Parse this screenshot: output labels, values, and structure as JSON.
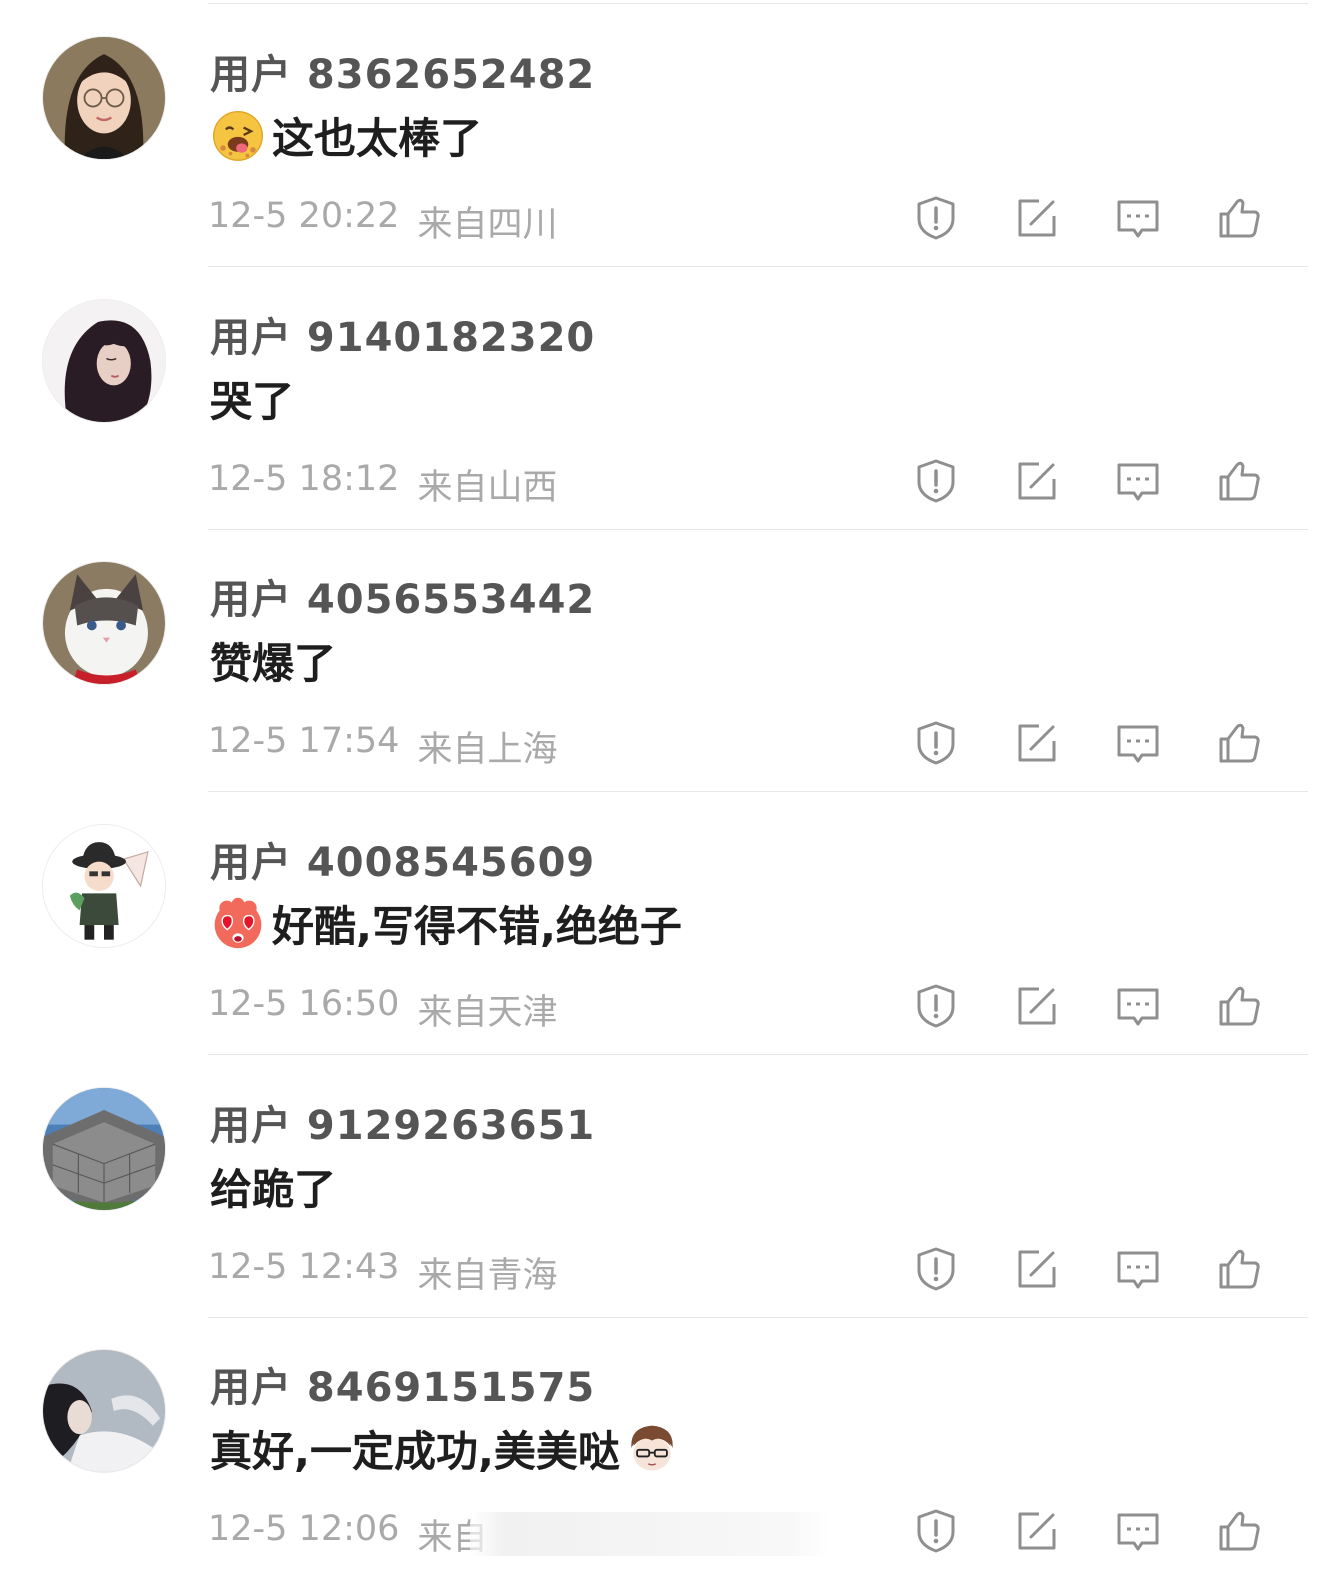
{
  "comments": [
    {
      "username": "用户 8362652482",
      "text": "这也太棒了",
      "emoji": "licking-lips-emoji",
      "emoji_pos": "before",
      "time": "12-5 20:22",
      "location": "来自四川",
      "avatar": "girl-with-glasses-avatar"
    },
    {
      "username": "用户 9140182320",
      "text": "哭了",
      "emoji": null,
      "time": "12-5 18:12",
      "location": "来自山西",
      "avatar": "long-hair-girl-avatar"
    },
    {
      "username": "用户 4056553442",
      "text": "赞爆了",
      "emoji": null,
      "time": "12-5 17:54",
      "location": "来自上海",
      "avatar": "ragdoll-cat-avatar"
    },
    {
      "username": "用户 4008545609",
      "text": "好酷,写得不错,绝绝子",
      "emoji": "heart-eyes-emoji",
      "emoji_pos": "before",
      "time": "12-5 16:50",
      "location": "来自天津",
      "avatar": "cartoon-man-hat-avatar"
    },
    {
      "username": "用户 9129263651",
      "text": "给跪了",
      "emoji": null,
      "time": "12-5 12:43",
      "location": "来自青海",
      "avatar": "castle-courtyard-avatar"
    },
    {
      "username": "用户 8469151575",
      "text": "真好,一定成功,美美哒",
      "emoji": "anime-boy-sunglasses-emoji",
      "emoji_pos": "after",
      "time": "12-5 12:06",
      "location": "来自",
      "avatar": "dark-portrait-avatar"
    }
  ],
  "action_icons": [
    "report-icon",
    "repost-icon",
    "comment-icon",
    "like-icon"
  ],
  "colors": {
    "username": "#555555",
    "text": "#1e1e1e",
    "meta": "#a9a9a9",
    "icon": "#8f8f8f",
    "divider": "#e6e6e6"
  }
}
